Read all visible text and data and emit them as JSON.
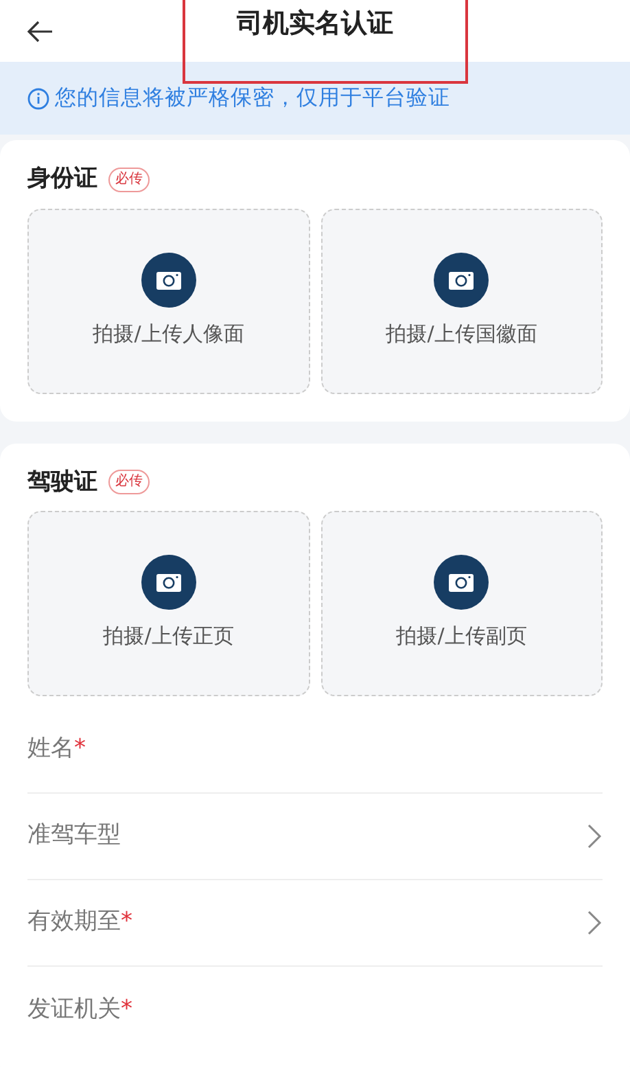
{
  "header": {
    "title": "司机实名认证",
    "highlighted": true
  },
  "notice": {
    "text": "您的信息将被严格保密，仅用于平台验证"
  },
  "sections": [
    {
      "title": "身份证",
      "badge": "必传",
      "uploads": [
        {
          "label": "拍摄/上传人像面"
        },
        {
          "label": "拍摄/上传国徽面"
        }
      ]
    },
    {
      "title": "驾驶证",
      "badge": "必传",
      "uploads": [
        {
          "label": "拍摄/上传正页"
        },
        {
          "label": "拍摄/上传副页"
        }
      ],
      "fields": [
        {
          "label": "姓名",
          "required_mark": "*",
          "has_arrow": false
        },
        {
          "label": "准驾车型",
          "has_arrow": true
        },
        {
          "label": "有效期至",
          "required_mark": "*",
          "has_arrow": true
        },
        {
          "label": "发证机关",
          "required_mark": "*",
          "has_arrow": false
        }
      ]
    }
  ]
}
